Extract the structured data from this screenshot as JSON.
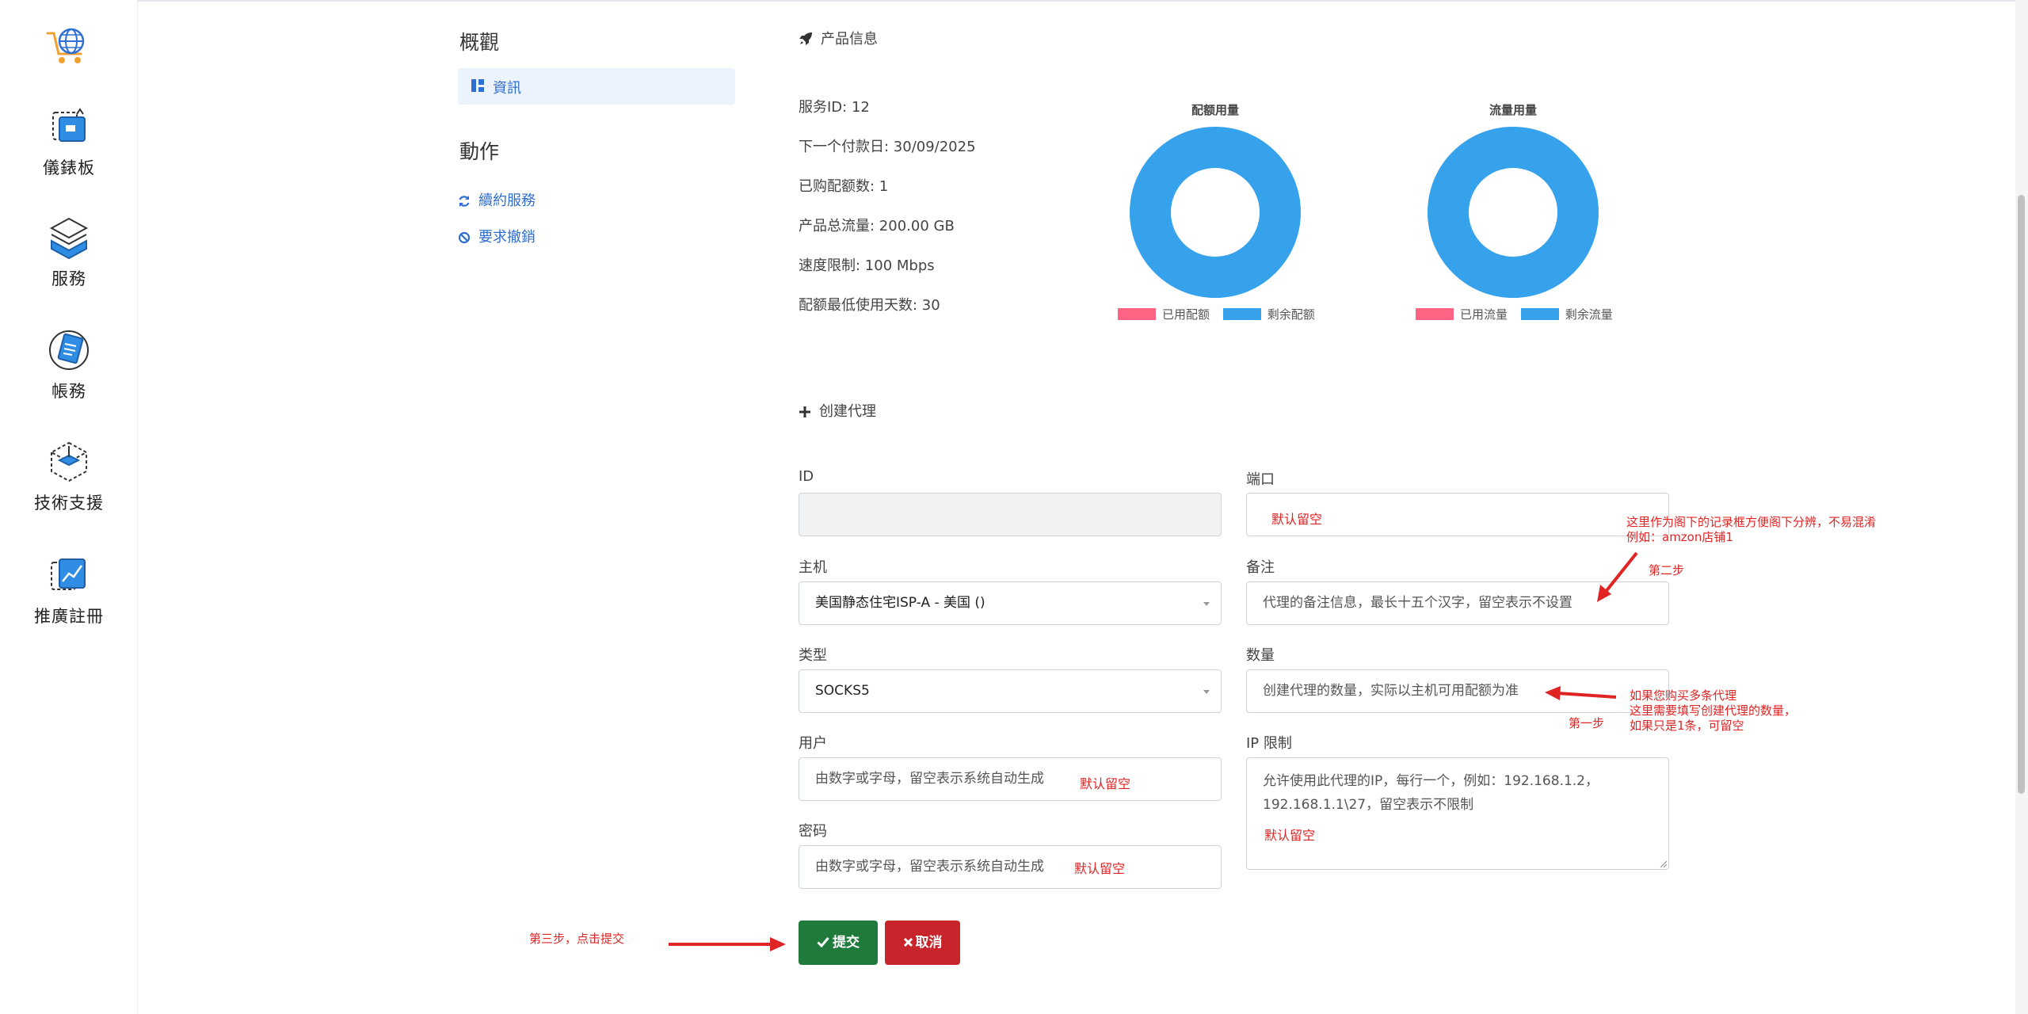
{
  "sidebar": {
    "logo_icon": "globe-cart-icon",
    "items": [
      {
        "label": "儀錶板",
        "icon": "dashboard-icon"
      },
      {
        "label": "服務",
        "icon": "services-icon"
      },
      {
        "label": "帳務",
        "icon": "billing-icon"
      },
      {
        "label": "技術支援",
        "icon": "support-icon"
      },
      {
        "label": "推廣註冊",
        "icon": "affiliate-icon"
      }
    ]
  },
  "menu": {
    "overview_heading": "概觀",
    "info_item": "資訊",
    "actions_heading": "動作",
    "renew_link": "續約服務",
    "cancel_link": "要求撤銷"
  },
  "product": {
    "section_title": "产品信息",
    "lines": [
      "服务ID: 12",
      "下一个付款日: 30/09/2025",
      "已购配额数: 1",
      "产品总流量: 200.00 GB",
      "速度限制: 100 Mbps",
      "配额最低使用天数: 30"
    ]
  },
  "chart_data": [
    {
      "type": "pie",
      "title": "配额用量",
      "labels": [
        "已用配额",
        "剩余配额"
      ],
      "values": [
        0,
        1
      ],
      "colors": [
        "#ff6384",
        "#36a2eb"
      ]
    },
    {
      "type": "pie",
      "title": "流量用量",
      "labels": [
        "已用流量",
        "剩余流量"
      ],
      "values": [
        0,
        200
      ],
      "colors": [
        "#ff6384",
        "#36a2eb"
      ]
    }
  ],
  "form": {
    "section_title": "创建代理",
    "id_label": "ID",
    "id_value": "",
    "host_label": "主机",
    "host_value": "美国静态住宅ISP-A - 美国 ()",
    "type_label": "类型",
    "type_value": "SOCKS5",
    "user_label": "用户",
    "user_placeholder": "由数字或字母，留空表示系统自动生成",
    "password_label": "密码",
    "password_placeholder": "由数字或字母，留空表示系统自动生成",
    "port_label": "端口",
    "port_value": "",
    "remark_label": "备注",
    "remark_placeholder": "代理的备注信息，最长十五个汉字，留空表示不设置",
    "quantity_label": "数量",
    "quantity_placeholder": "创建代理的数量，实际以主机可用配额为准",
    "ip_limit_label": "IP 限制",
    "ip_limit_placeholder_1": "允许使用此代理的IP，每行一个，例如：192.168.1.2，",
    "ip_limit_placeholder_2": "192.168.1.1\\27，留空表示不限制",
    "submit_label": "提交",
    "cancel_label": "取消"
  },
  "annotations": {
    "port_default": "默认留空",
    "user_default": "默认留空",
    "password_default": "默认留空",
    "ip_default": "默认留空",
    "remark_note_1": "这里作为阁下的记录框方便阁下分辨，不易混淆",
    "remark_note_2": "例如：amzon店铺1",
    "step2": "第二步",
    "quantity_note_1": "如果您购买多条代理",
    "quantity_note_2": "这里需要填写创建代理的数量，",
    "quantity_note_3": "如果只是1条，可留空",
    "step1": "第一步",
    "step3": "第三步，点击提交"
  },
  "colors": {
    "link_blue": "#2f6fd1",
    "submit_green": "#1f7a3c",
    "cancel_red": "#c7242c",
    "annotation_red": "#e02424"
  }
}
